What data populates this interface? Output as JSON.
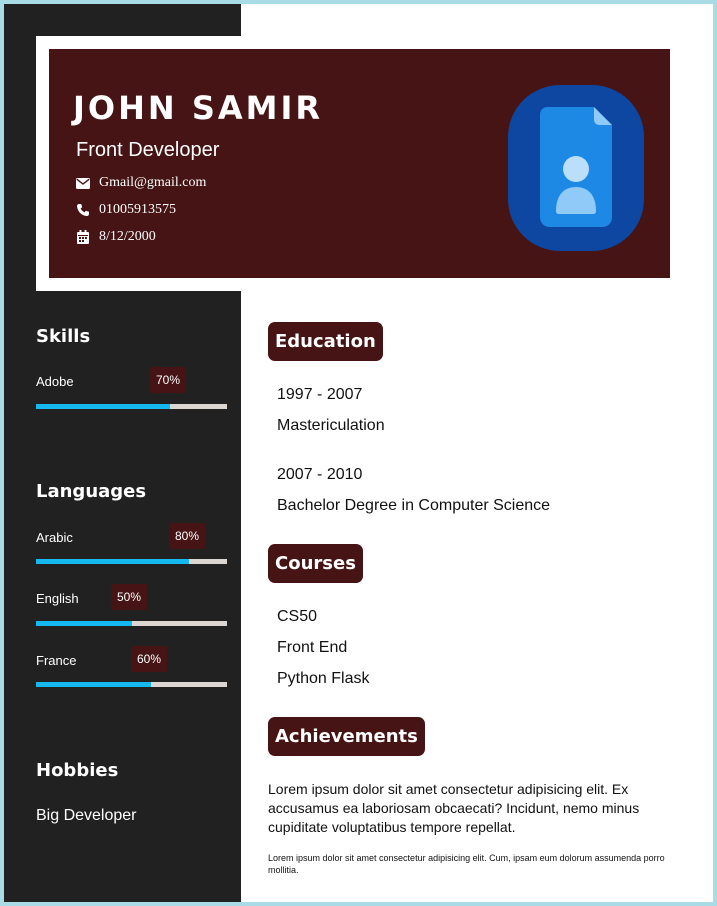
{
  "header": {
    "name": "JOHN SAMIR",
    "role": "Front Developer",
    "email": "Gmail@gmail.com",
    "phone": "01005913575",
    "dob": "8/12/2000"
  },
  "sidebar": {
    "skills_title": "Skills",
    "skills": [
      {
        "label": "Adobe",
        "percent_text": "70%",
        "level": 70
      }
    ],
    "languages_title": "Languages",
    "languages": [
      {
        "label": "Arabic",
        "percent_text": "80%",
        "level": 80
      },
      {
        "label": "English",
        "percent_text": "50%",
        "level": 50
      },
      {
        "label": "France",
        "percent_text": "60%",
        "level": 60
      }
    ],
    "hobbies_title": "Hobbies",
    "hobby": "Big Developer"
  },
  "main": {
    "education_title": "Education",
    "education": [
      {
        "years": "1997 - 2007",
        "degree": "Mastericulation"
      },
      {
        "years": "2007 - 2010",
        "degree": "Bachelor Degree in Computer Science"
      }
    ],
    "courses_title": "Courses",
    "courses": [
      "CS50",
      "Front End",
      "Python Flask"
    ],
    "achievements_title": "Achievements",
    "achievements_text": "Lorem ipsum dolor sit amet consectetur adipisicing elit. Ex accusamus ea laboriosam obcaecati? Incidunt, nemo minus cupiditate voluptatibus tempore repellat.",
    "achievements_small": "Lorem ipsum dolor sit amet consectetur adipisicing elit. Cum, ipsam eum dolorum assumenda porro mollitia."
  },
  "colors": {
    "accent": "#461414",
    "sidebar": "#212121",
    "bar_fill": "#16b8f0",
    "bar_track": "#dcd6d3",
    "frame": "#a9dbe6"
  },
  "icons": [
    "envelope-icon",
    "phone-icon",
    "calendar-icon",
    "contact-card-icon"
  ]
}
